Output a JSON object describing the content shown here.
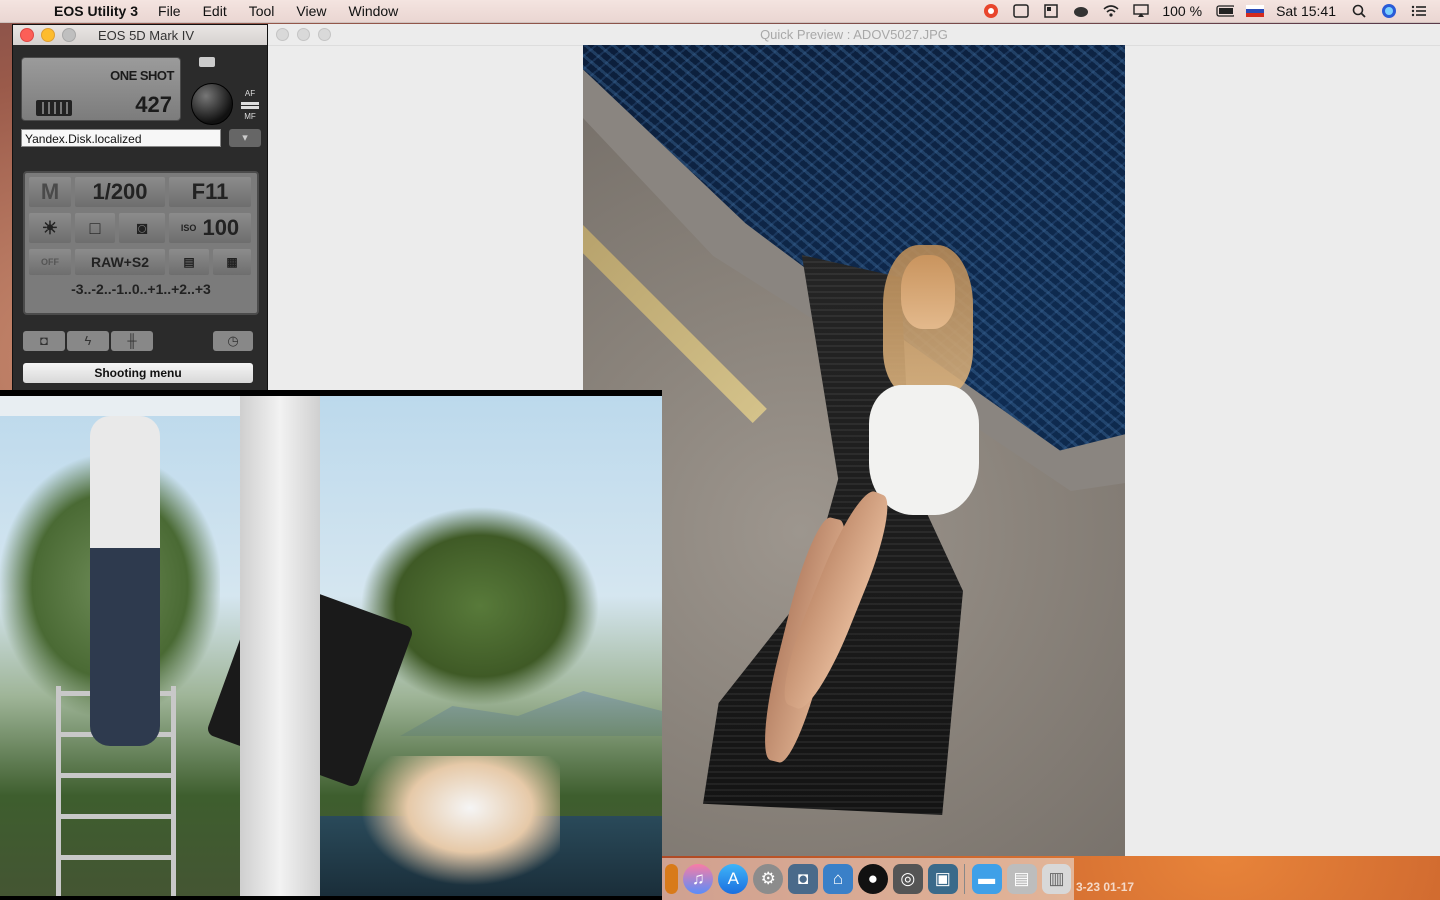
{
  "menubar": {
    "app_name": "EOS Utility 3",
    "menus": [
      "File",
      "Edit",
      "Tool",
      "View",
      "Window"
    ],
    "battery": "100 %",
    "clock": "Sat 15:41"
  },
  "eos_panel": {
    "window_title": "EOS 5D Mark IV",
    "af_mode": "ONE SHOT",
    "shots_remaining": "427",
    "af_label": "AF",
    "mf_label": "MF",
    "folder": "Yandex.Disk.localized",
    "shooting_mode": "M",
    "shutter_speed": "1/200",
    "aperture": "F11",
    "iso_label": "ISO",
    "iso": "100",
    "image_quality": "RAW+S2",
    "exposure_scale": "-3..-2..-1..0..+1..+2..+3",
    "off_label": "OFF",
    "shooting_menu": "Shooting menu"
  },
  "quick_preview": {
    "title": "Quick Preview : ADOV5027.JPG"
  },
  "desktop": {
    "corner_text": "3-23 01-17"
  },
  "icons": {
    "apple": "apple-logo-icon",
    "search": "spotlight-search-icon",
    "wifi": "wifi-icon"
  },
  "colors": {
    "close_red": "#fc5f57",
    "minimize_yellow": "#fdbc2e",
    "menubar_bg": "#f0dfdb",
    "lcd_gray": "#7b7b7b"
  }
}
